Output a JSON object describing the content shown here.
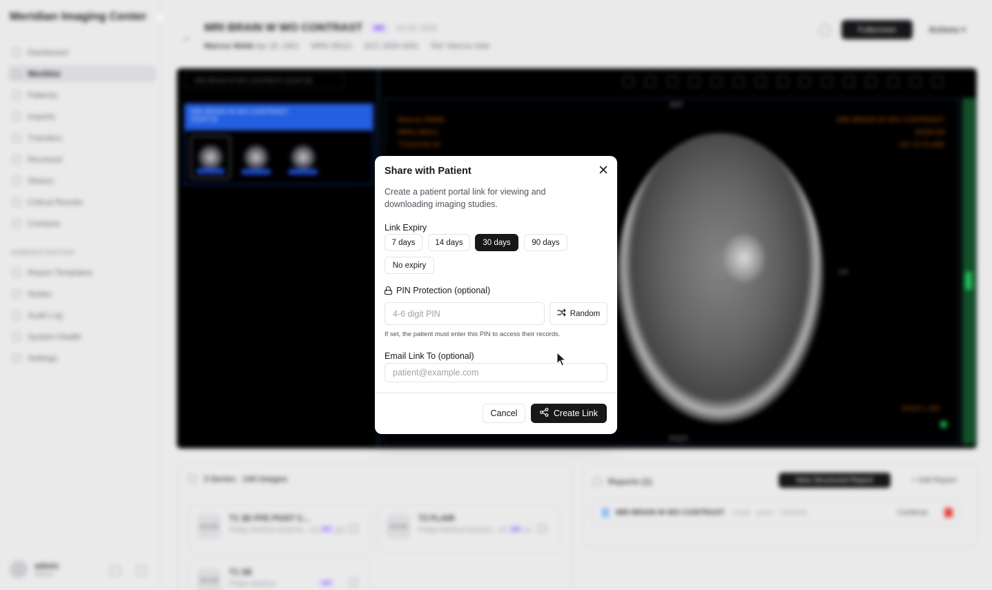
{
  "modal": {
    "title": "Share with Patient",
    "description": "Create a patient portal link for viewing and downloading imaging studies.",
    "close_icon": "close-icon",
    "link_expiry": {
      "label": "Link Expiry",
      "options": [
        "7 days",
        "14 days",
        "30 days",
        "90 days",
        "No expiry"
      ],
      "selected": "30 days"
    },
    "pin": {
      "label": "PIN Protection (optional)",
      "icon": "lock-icon",
      "placeholder": "4-6 digit PIN",
      "value": "",
      "random_label": "Random",
      "random_icon": "shuffle-icon",
      "hint": "If set, the patient must enter this PIN to access their records."
    },
    "email": {
      "label": "Email Link To (optional)",
      "placeholder": "patient@example.com",
      "value": ""
    },
    "cancel_label": "Cancel",
    "create_label": "Create Link",
    "create_icon": "share-icon"
  },
  "background": {
    "app_name": "Meridian Imaging Center",
    "nav": [
      "Dashboard",
      "Worklist",
      "Patients",
      "Imports",
      "Transfers",
      "Received",
      "Shares",
      "Critical Results",
      "Contacts"
    ],
    "nav_active": "Worklist",
    "admin_section": "ADMINISTRATION",
    "admin_nav": [
      "Report Templates",
      "Nodes",
      "Audit Log",
      "System Health",
      "Settings"
    ],
    "user": {
      "name": "admin",
      "role": "Admin"
    },
    "study": {
      "title": "MRI BRAIN W WO CONTRAST",
      "modality": "MR",
      "date": "Jul 18, 2026",
      "patient": "Marcus Webb",
      "dob": "Apr 18, 1961",
      "mrn": "MRN 39012",
      "acc": "ACC 2826-4081",
      "ref": "Ref: Marcus Hale"
    },
    "header_dark_btn": "Fullscreen",
    "header_actions": "Actions",
    "viewer": {
      "series_header": "MRI BRAIN W WO CONTRAST (2026718)",
      "series_box_title": "MRI BRAIN W WO CONTRAST",
      "series_box_sub": "2026718",
      "overlay_left": [
        "Marcus Webb",
        "MRN 39012",
        "7/16/2026 M"
      ],
      "overlay_right": [
        "MRI BRAIN W WO CONTRAST",
        "2026718",
        "AX T2 FLAIR"
      ],
      "ant": "ANT",
      "post": "POST",
      "lat": "LH",
      "window": "W:815 L:360"
    },
    "series_panel": {
      "title": "3 Series · 144 images",
      "cards": [
        {
          "name": "T1 3D FFE POST C...",
          "vendor": "Philips Medical Systems",
          "count": "102 images",
          "modality": "MR"
        },
        {
          "name": "T2 FLAIR",
          "vendor": "Philips Medical Systems",
          "count": "22 images",
          "modality": "MR"
        },
        {
          "name": "T1 SE",
          "vendor": "Philips Medical",
          "count": "",
          "modality": "MR"
        }
      ]
    },
    "reports_panel": {
      "title": "Reports (1)",
      "new_btn": "New Structured Report",
      "add_btn": "Add Report",
      "row_title": "MRI BRAIN W WO CONTRAST",
      "row_status": "v Draft",
      "row_meta": "admin · 7/25/2026",
      "continue": "Continue"
    }
  }
}
